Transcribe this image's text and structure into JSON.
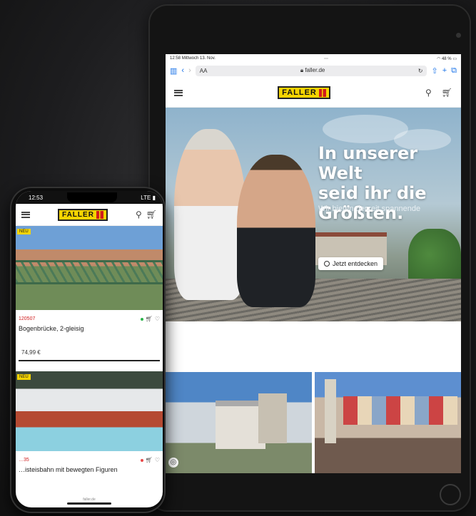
{
  "tablet": {
    "status": {
      "time": "12:58",
      "date": "Mittwoch 13. Nov.",
      "battery": "48 %"
    },
    "browser": {
      "text_size": "AA",
      "url": "faller.de"
    },
    "site": {
      "logo": "FALLER"
    },
    "hero": {
      "title_line1": "In unserer Welt",
      "title_line2": "seid ihr die",
      "title_line3": "Größten.",
      "subtitle": "Wir bieten derzeit spannende",
      "cta": "Jetzt entdecken"
    }
  },
  "phone": {
    "status": {
      "time": "12:53",
      "network": "LTE"
    },
    "site": {
      "logo": "FALLER"
    },
    "products": [
      {
        "badge": "NEU",
        "sku": "120507",
        "name": "Bogenbrücke, 2-gleisig",
        "price": "74,99 €"
      },
      {
        "badge": "NEU",
        "sku": "…35",
        "name": "…isteisbahn mit bewegten Figuren"
      }
    ],
    "footer_url": "faller.de"
  },
  "colors": {
    "brand_yellow": "#f5d400",
    "brand_red": "#d01c1c",
    "ios_blue": "#1a73e8"
  }
}
